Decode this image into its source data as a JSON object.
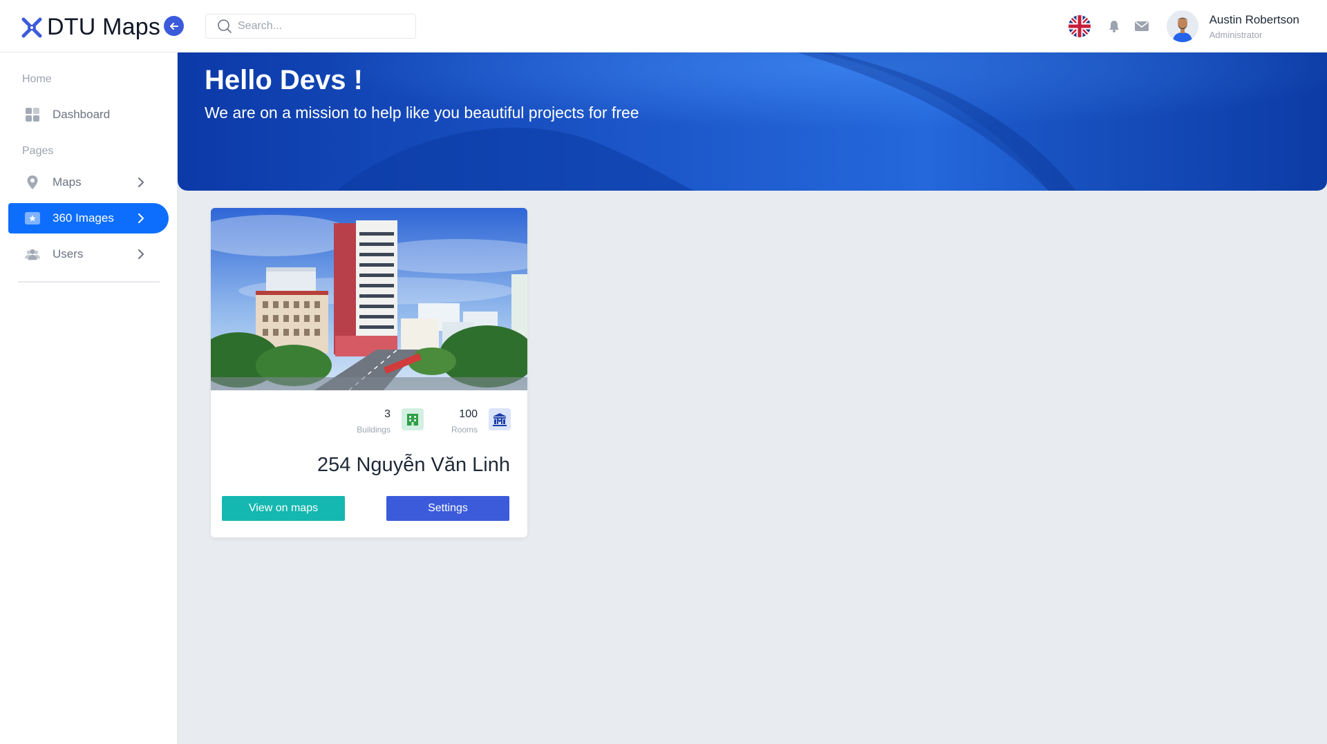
{
  "app": {
    "name": "DTU Maps"
  },
  "search": {
    "placeholder": "Search..."
  },
  "user": {
    "name": "Austin Robertson",
    "role": "Administrator"
  },
  "sidebar": {
    "sections": [
      {
        "label": "Home",
        "items": [
          {
            "label": "Dashboard",
            "icon": "dashboard-grid-icon",
            "has_chevron": false,
            "active": false
          }
        ]
      },
      {
        "label": "Pages",
        "items": [
          {
            "label": "Maps",
            "icon": "map-pin-icon",
            "has_chevron": true,
            "active": false
          },
          {
            "label": "360 Images",
            "icon": "image-icon",
            "has_chevron": true,
            "active": true
          },
          {
            "label": "Users",
            "icon": "users-icon",
            "has_chevron": true,
            "active": false
          }
        ]
      }
    ]
  },
  "hero": {
    "title": "Hello Devs !",
    "subtitle": "We are on a mission to help like you beautiful projects for free"
  },
  "card": {
    "stats": [
      {
        "value": "3",
        "label": "Buildings",
        "icon": "buildings-icon"
      },
      {
        "value": "100",
        "label": "Rooms",
        "icon": "rooms-icon"
      }
    ],
    "title": "254 Nguyễn Văn Linh",
    "buttons": {
      "view_on_maps": "View on maps",
      "settings": "Settings"
    }
  },
  "colors": {
    "primary": "#0d6efd",
    "accent": "#3b5bdb",
    "teal": "#14b8b0",
    "background": "#e8ebef"
  }
}
